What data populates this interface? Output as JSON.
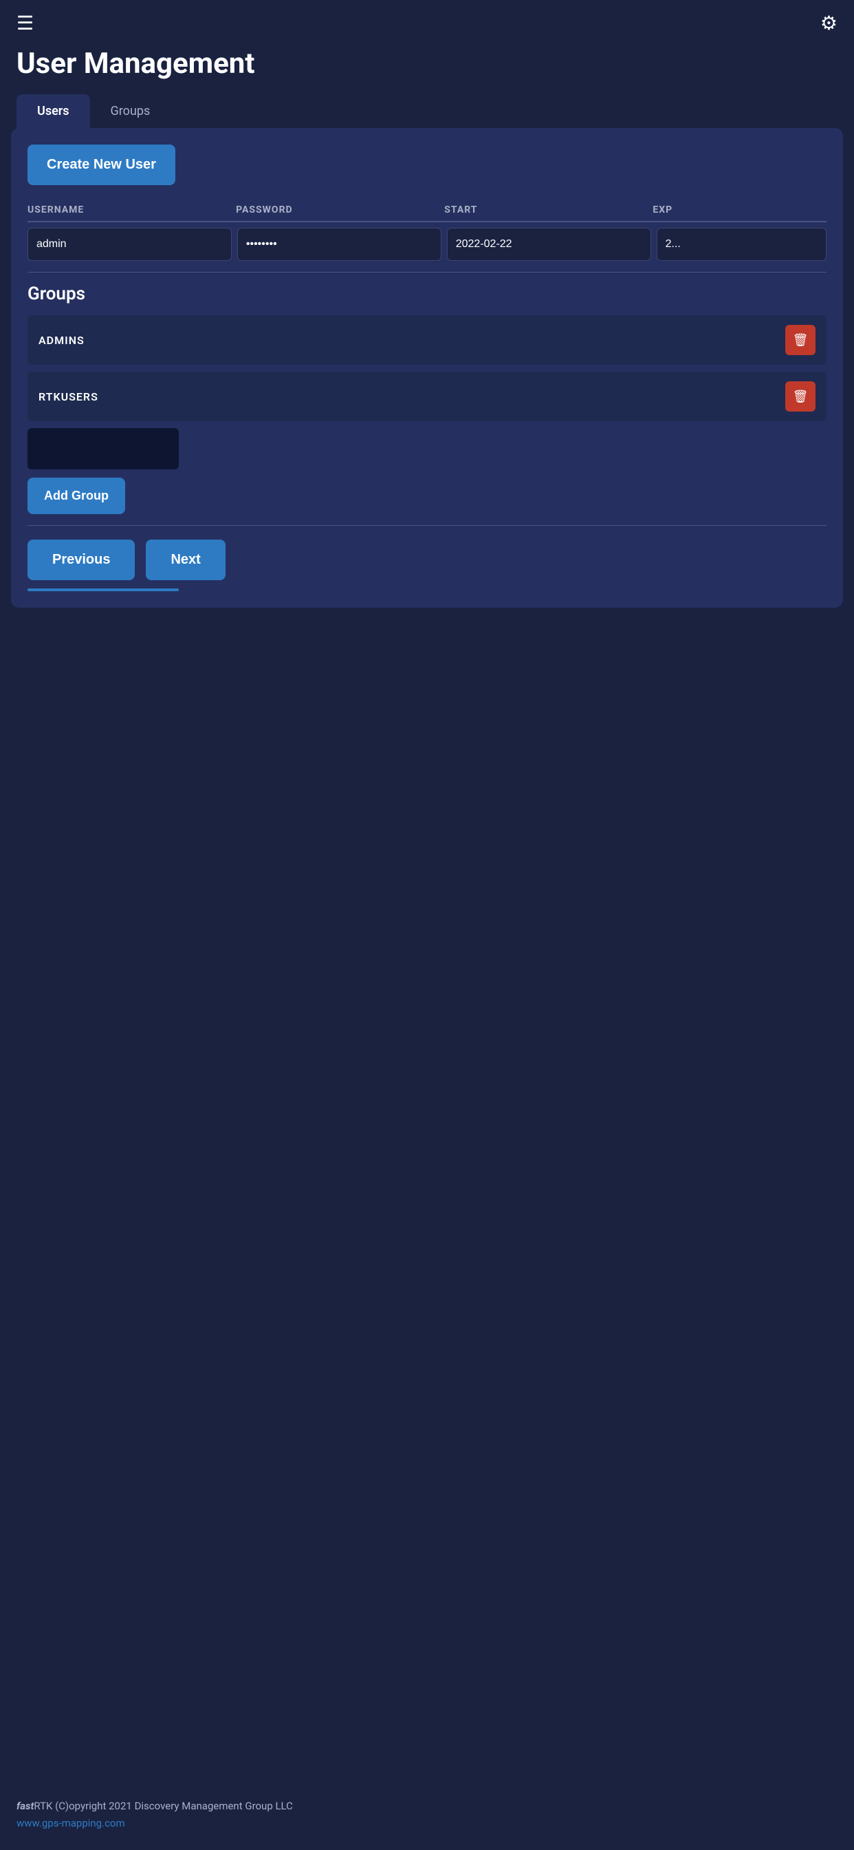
{
  "header": {
    "title": "User Management",
    "menu_icon": "☰",
    "settings_icon": "✦"
  },
  "tabs": [
    {
      "label": "Users",
      "active": true
    },
    {
      "label": "Groups",
      "active": false
    }
  ],
  "users_tab": {
    "create_button_label": "Create New User",
    "table": {
      "headers": [
        "USERNAME",
        "PASSWORD",
        "START",
        "EXP"
      ],
      "rows": [
        {
          "username": "admin",
          "password": "••••••••",
          "start": "2022-02-22",
          "exp": "2..."
        }
      ]
    },
    "groups_section": {
      "title": "Groups",
      "groups": [
        {
          "name": "ADMINS"
        },
        {
          "name": "RTKUSERS"
        }
      ],
      "add_group_button_label": "Add Group"
    },
    "navigation": {
      "previous_label": "Previous",
      "next_label": "Next"
    }
  },
  "footer": {
    "brand_italic": "fast",
    "brand_rest": "RTK",
    "copyright": "  (C)opyright 2021 Discovery Management Group LLC",
    "link_text": "www.gps-mapping.com",
    "link_href": "http://www.gps-mapping.com"
  }
}
